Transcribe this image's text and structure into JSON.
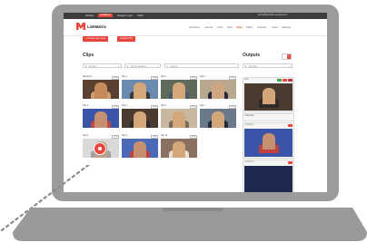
{
  "topbar": {
    "items": [
      "Website",
      "LinkMatrix",
      "Reagent Login",
      "OMNI"
    ],
    "active_index": 1,
    "user_text": "admin@linkmatrix.example.com"
  },
  "app": {
    "name": "LinkMatrix",
    "brand_color": "#e8453c"
  },
  "nav": {
    "items": [
      "Overview",
      "Events",
      "Units",
      "Files",
      "Clips",
      "Paths",
      "Outputs",
      "Users",
      "Settings"
    ],
    "current_index": 4
  },
  "actions": {
    "create_label": "+ Create new route",
    "upload_label": "Upload PTZ"
  },
  "clips": {
    "title": "Clips",
    "filter_all": "All clips",
    "filter_device": "Sort by duration",
    "search_placeholder": "Search",
    "items": [
      {
        "label": "Reporters",
        "tag": "LIVE"
      },
      {
        "label": "Clip 1",
        "tag": "LIVE"
      },
      {
        "label": "Clip 2",
        "tag": "LIVE"
      },
      {
        "label": "Clip 3",
        "tag": "LIVE"
      },
      {
        "label": "Clip 4",
        "tag": "LIVE"
      },
      {
        "label": "Clip 5",
        "tag": "LIVE"
      },
      {
        "label": "Clip 6",
        "tag": "LIVE"
      },
      {
        "label": "Clip 7",
        "tag": "LIVE"
      },
      {
        "label": "Clip 8",
        "tag": "LIVE"
      },
      {
        "label": "Clip 9",
        "tag": "LIVE"
      },
      {
        "label": "Clip 10",
        "tag": "LIVE"
      }
    ]
  },
  "outputs": {
    "title": "Outputs",
    "filter": "Program",
    "cards": [
      {
        "label": "RTP"
      },
      {
        "label": "PREVIEW"
      },
      {
        "label": "OUTPUT 1"
      },
      {
        "label": "OUTPUT 2"
      }
    ]
  },
  "icons": {
    "search": "search-icon",
    "filter": "filter-icon",
    "add": "add-icon",
    "close": "close-icon"
  }
}
